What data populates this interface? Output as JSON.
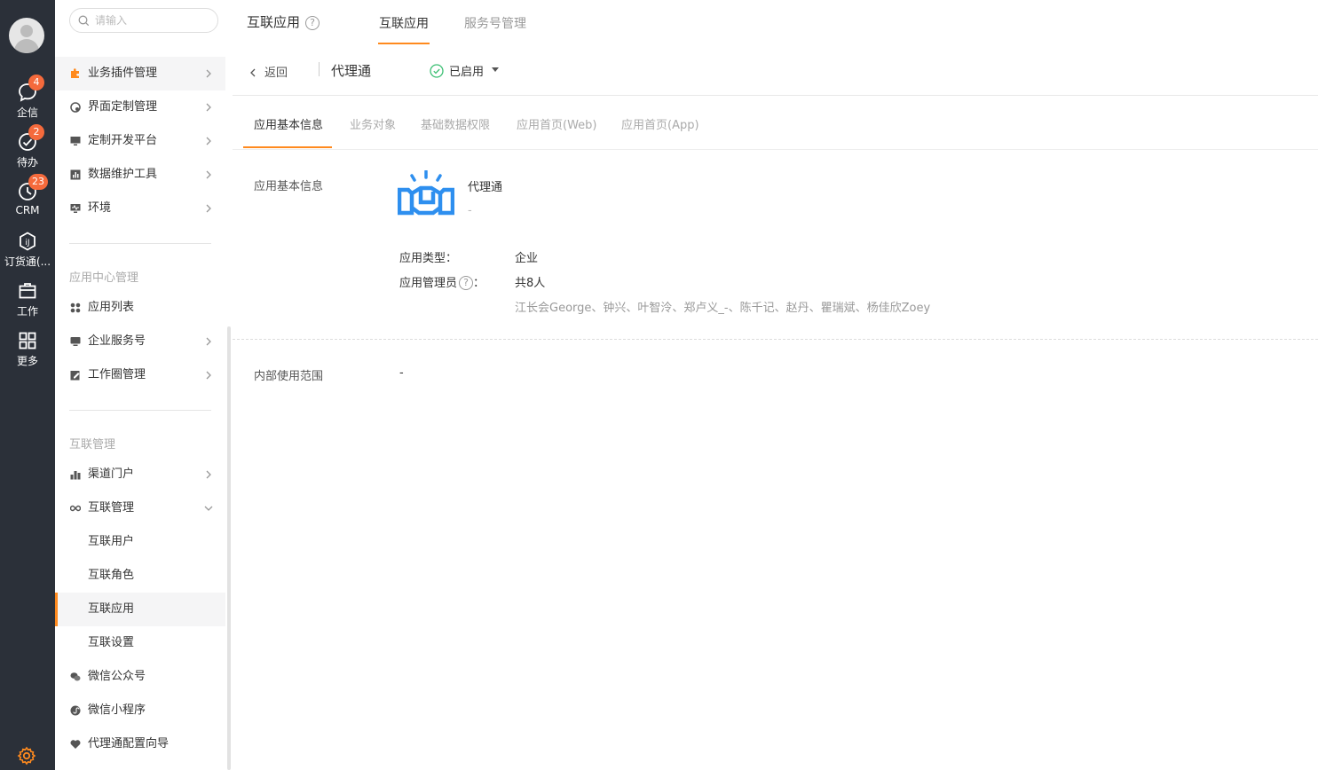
{
  "rail": {
    "items": [
      {
        "label": "企信",
        "badge": "4"
      },
      {
        "label": "待办",
        "badge": "2"
      },
      {
        "label": "CRM",
        "badge": "23"
      },
      {
        "label": "订货通(...",
        "badge": ""
      },
      {
        "label": "工作",
        "badge": ""
      },
      {
        "label": "更多",
        "badge": ""
      }
    ]
  },
  "menu": {
    "search_placeholder": "请输入",
    "items": [
      {
        "label": "业务插件管理"
      },
      {
        "label": "界面定制管理"
      },
      {
        "label": "定制开发平台"
      },
      {
        "label": "数据维护工具"
      },
      {
        "label": "环境"
      }
    ],
    "group_app_center": "应用中心管理",
    "app_items": [
      {
        "label": "应用列表"
      },
      {
        "label": "企业服务号"
      },
      {
        "label": "工作圈管理"
      }
    ],
    "group_interconnect": "互联管理",
    "ic_items": [
      {
        "label": "渠道门户"
      },
      {
        "label": "互联管理"
      },
      {
        "label": "互联用户"
      },
      {
        "label": "互联角色"
      },
      {
        "label": "互联应用"
      },
      {
        "label": "互联设置"
      },
      {
        "label": "微信公众号"
      },
      {
        "label": "微信小程序"
      },
      {
        "label": "代理通配置向导"
      }
    ]
  },
  "header": {
    "title": "互联应用",
    "help": "?",
    "tabs": [
      {
        "label": "互联应用"
      },
      {
        "label": "服务号管理"
      }
    ]
  },
  "detail": {
    "back": "返回",
    "app_name": "代理通",
    "status": "已启用",
    "sub_tabs": [
      {
        "label": "应用基本信息"
      },
      {
        "label": "业务对象"
      },
      {
        "label": "基础数据权限"
      },
      {
        "label": "应用首页(Web)"
      },
      {
        "label": "应用首页(App)"
      }
    ],
    "basic_section_label": "应用基本信息",
    "app_display_name": "代理通",
    "app_desc": "-",
    "type_key": "应用类型：",
    "type_value": "企业",
    "admin_key": "应用管理员",
    "admin_colon": "：",
    "admin_count": "共8人",
    "admin_names": "江长会George、钟兴、叶智泠、郑卢义_-、陈千记、赵丹、瞿瑞斌、杨佳欣Zoey",
    "range_label": "内部使用范围",
    "range_value": "-"
  },
  "colors": {
    "accent": "#ff8a1e",
    "rail_bg": "#2b3039",
    "badge": "#f56a3c",
    "logo_blue": "#2e8fef",
    "status_green": "#3bbf73"
  }
}
